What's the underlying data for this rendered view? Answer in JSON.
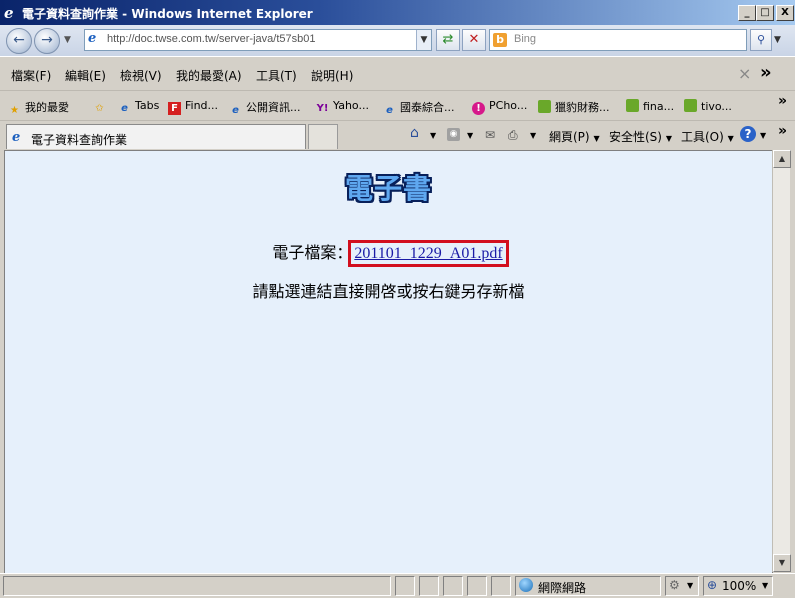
{
  "window": {
    "title": "電子資料查詢作業 - Windows Internet Explorer",
    "controls": {
      "minimize": "_",
      "maximize": "□",
      "close": "X"
    }
  },
  "nav": {
    "back_icon": "←",
    "forward_icon": "→",
    "address_url": "http://doc.twse.com.tw/server-java/t57sb01",
    "search_placeholder": "Bing",
    "refresh_icon": "⇄",
    "stop_icon": "✕",
    "search_go_icon": "🔍"
  },
  "menu": {
    "items": [
      "檔案(F)",
      "編輯(E)",
      "檢視(V)",
      "我的最愛(A)",
      "工具(T)",
      "說明(H)"
    ],
    "close_icon": "×",
    "chevron": "»"
  },
  "favorites": {
    "label": "我的最愛",
    "items": [
      "Tabs",
      "Find...",
      "公開資訊...",
      "Yaho...",
      "國泰綜合...",
      "PCho...",
      "獵豹財務...",
      "fina...",
      "tivo..."
    ],
    "chevron": "»"
  },
  "tabs": {
    "active_label": "電子資料查詢作業"
  },
  "commandbar": {
    "page": "網頁(P)",
    "safety": "安全性(S)",
    "tools": "工具(O)",
    "help": "?"
  },
  "content": {
    "heading": "電子書",
    "file_label": "電子檔案：",
    "file_link": "201101_1229_A01.pdf",
    "hint": "請點選連結直接開啓或按右鍵另存新檔"
  },
  "status": {
    "zone": "網際網路",
    "zoom": "100%"
  },
  "colors": {
    "highlight_box": "#d20f1e",
    "content_bg": "#e6f0fb",
    "link": "#1a1aa6"
  }
}
